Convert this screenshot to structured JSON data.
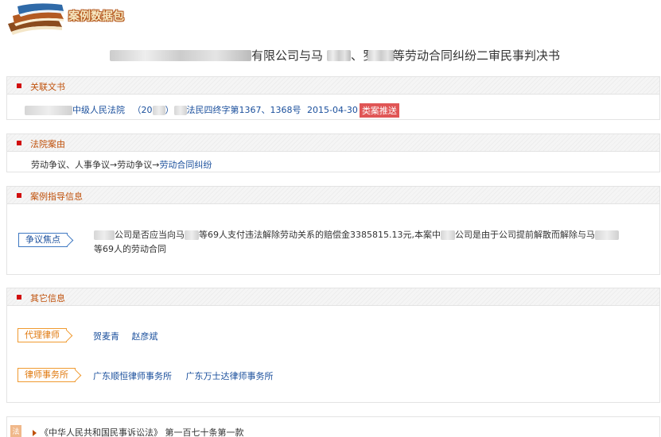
{
  "header": {
    "brand": "案例数据包"
  },
  "title": {
    "mid": "有限公司与马",
    "mid2": "、罗",
    "end": "等劳动合同纠纷二审民事判决书"
  },
  "related": {
    "heading": "关联文书",
    "court": "中级人民法院",
    "paren_open": "（20",
    "paren_close": "）",
    "case_no": "法民四终字第1367、1368号",
    "date": "2015-04-30",
    "tag": "类案推送"
  },
  "cause": {
    "heading": "法院案由",
    "path": "劳动争议、人事争议→劳动争议→",
    "leaf": "劳动合同纠纷"
  },
  "guidance": {
    "heading": "案例指导信息",
    "label": "争议焦点",
    "line1_a": "公司是否应当向马",
    "line1_b": "等69人支付违法解除劳动关系的赔偿金3385815.13元,本案中",
    "line1_c": "公司是由于公司提前解散而解除与马",
    "line2": "等69人的劳动合同"
  },
  "other": {
    "heading": "其它信息",
    "lawyer_label": "代理律师",
    "lawyers": [
      "贺麦青",
      "赵彦斌"
    ],
    "firm_label": "律师事务所",
    "firms": [
      "广东顺恒律师事务所",
      "广东万士达律师事务所"
    ]
  },
  "law": {
    "icon": "法",
    "text": "《中华人民共和国民事诉讼法》 第一百七十条第一款"
  }
}
